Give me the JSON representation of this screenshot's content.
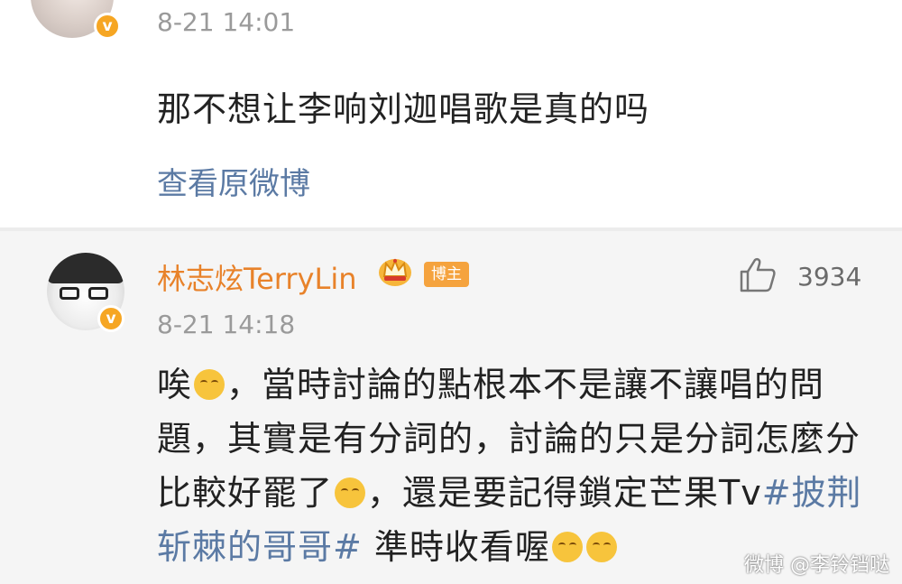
{
  "comment1": {
    "time": "8-21 14:01",
    "content": "那不想让李响刘迦唱歌是真的吗",
    "view_link": "查看原微博",
    "verified_mark": "v"
  },
  "comment2": {
    "author": "林志炫TerryLin",
    "author_badge": "博主",
    "crown_icon": "crown-icon",
    "verified_mark": "v",
    "likes": "3934",
    "time": "8-21 14:18",
    "content_p1": "唉",
    "content_p2": "，當時討論的點根本不是讓不讓唱的問題，其實是有分詞的，討論的只是分詞怎麼分比較好罷了",
    "content_p3": "，還是要記得鎖定芒果Tv",
    "hashtag": "#披荆斩棘的哥哥#",
    "content_p4": " 準時收看喔"
  },
  "watermark": "微博 @李铃铛哒",
  "colors": {
    "link": "#5b7aa4",
    "username": "#e8822a",
    "badge": "#f5a33e",
    "verified": "#f6a623"
  }
}
